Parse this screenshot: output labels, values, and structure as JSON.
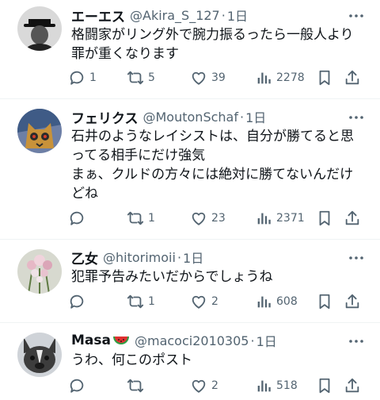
{
  "posts": [
    {
      "name": "エーエス",
      "handle": "@Akira_S_127",
      "time": "1日",
      "text": [
        "格闘家がリング外で腕力振るったら一般人より",
        "罪が重くなります"
      ],
      "replies": "1",
      "reposts": "5",
      "likes": "39",
      "views": "2278",
      "avatar_icon": "man-in-hat-avatar"
    },
    {
      "name": "フェリクス",
      "handle": "@MoutonSchaf",
      "time": "1日",
      "text": [
        "石井のようなレイシストは、自分が勝てると思",
        "ってる相手にだけ強気",
        "まぁ、クルドの方々には絶対に勝てないんだけ",
        "どね"
      ],
      "replies": "",
      "reposts": "1",
      "likes": "23",
      "views": "2371",
      "avatar_icon": "cat-illustration-avatar"
    },
    {
      "name": "乙女",
      "handle": "@hitorimoii",
      "time": "1日",
      "text": [
        "犯罪予告みたいだからでしょうね"
      ],
      "replies": "",
      "reposts": "1",
      "likes": "2",
      "views": "608",
      "avatar_icon": "flowers-avatar"
    },
    {
      "name": "Masa",
      "name_emoji": "watermelon-emoji",
      "handle": "@macoci2010305",
      "time": "1日",
      "text": [
        "うわ、何このポスト"
      ],
      "replies": "",
      "reposts": "",
      "likes": "2",
      "views": "518",
      "avatar_icon": "french-bulldog-avatar"
    }
  ],
  "separator": "·",
  "colors": {
    "text": "#0f1419",
    "secondary": "#536471",
    "divider": "#eff3f4"
  }
}
